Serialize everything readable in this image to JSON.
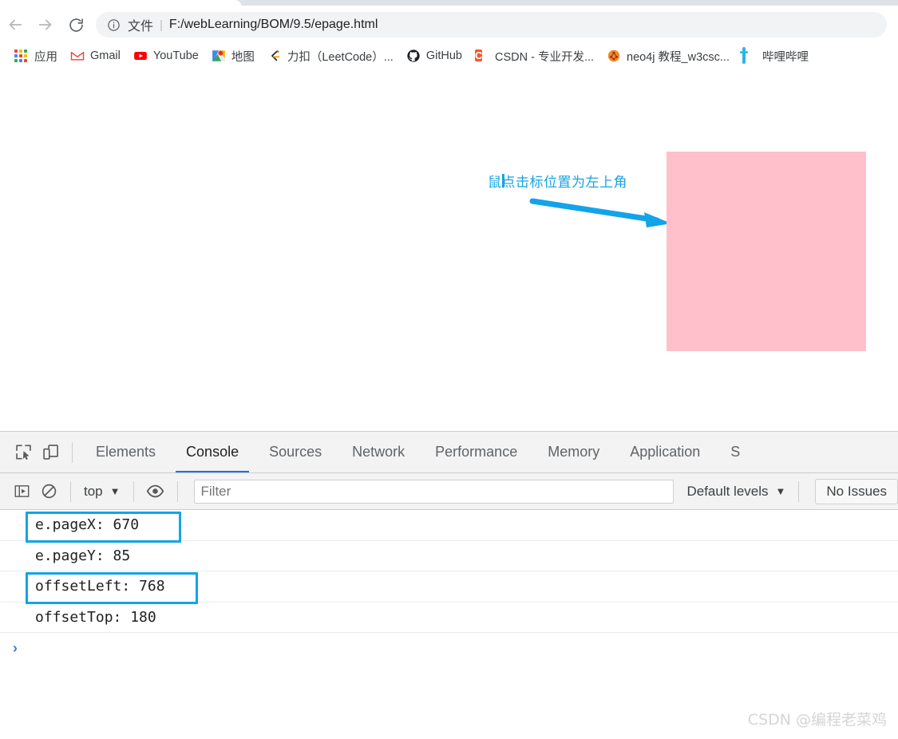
{
  "browser": {
    "nav": {
      "back_title": "Back",
      "forward_title": "Forward",
      "reload_title": "Reload"
    },
    "omnibox": {
      "info_icon": "info-circle-icon",
      "scheme_label": "文件",
      "separator": "|",
      "url": "F:/webLearning/BOM/9.5/epage.html"
    },
    "bookmarks": [
      {
        "icon": "apps-grid-icon",
        "label": "应用"
      },
      {
        "icon": "gmail-icon",
        "label": "Gmail"
      },
      {
        "icon": "youtube-icon",
        "label": "YouTube"
      },
      {
        "icon": "google-maps-icon",
        "label": "地图"
      },
      {
        "icon": "leetcode-icon",
        "label": "力扣（LeetCode）..."
      },
      {
        "icon": "github-icon",
        "label": "GitHub"
      },
      {
        "icon": "csdn-icon",
        "label": "CSDN - 专业开发..."
      },
      {
        "icon": "neo4j-icon",
        "label": "neo4j 教程_w3csc..."
      },
      {
        "icon": "bilibili-icon",
        "label": "哔哩哔哩"
      }
    ]
  },
  "page": {
    "annotation_text": "鼠点击标位置为左上角",
    "arrow_color": "#17a3e0",
    "box_color": "#ffc0cb",
    "cursor_icon": "text-cursor-icon"
  },
  "devtools": {
    "left_icons": [
      {
        "icon": "inspect-element-icon"
      },
      {
        "icon": "device-toolbar-icon"
      }
    ],
    "tabs": [
      {
        "label": "Elements",
        "active": false
      },
      {
        "label": "Console",
        "active": true
      },
      {
        "label": "Sources",
        "active": false
      },
      {
        "label": "Network",
        "active": false
      },
      {
        "label": "Performance",
        "active": false
      },
      {
        "label": "Memory",
        "active": false
      },
      {
        "label": "Application",
        "active": false
      },
      {
        "label": "S",
        "active": false
      }
    ],
    "console_toolbar": {
      "sidebar_icon": "console-sidebar-icon",
      "clear_icon": "clear-console-icon",
      "context_value": "top",
      "eye_icon": "live-expression-eye-icon",
      "filter_placeholder": "Filter",
      "filter_value": "",
      "levels_value": "Default levels",
      "issues_label": "No Issues",
      "caret": "▼"
    },
    "console_lines": [
      {
        "text": "e.pageX: 670",
        "highlighted": true
      },
      {
        "text": "e.pageY: 85",
        "highlighted": false
      },
      {
        "text": "offsetLeft: 768",
        "highlighted": true
      },
      {
        "text": "offsetTop: 180",
        "highlighted": false
      }
    ],
    "prompt_chevron": "›",
    "highlight_color": "#13a3e8"
  },
  "watermark": "CSDN @编程老菜鸡"
}
